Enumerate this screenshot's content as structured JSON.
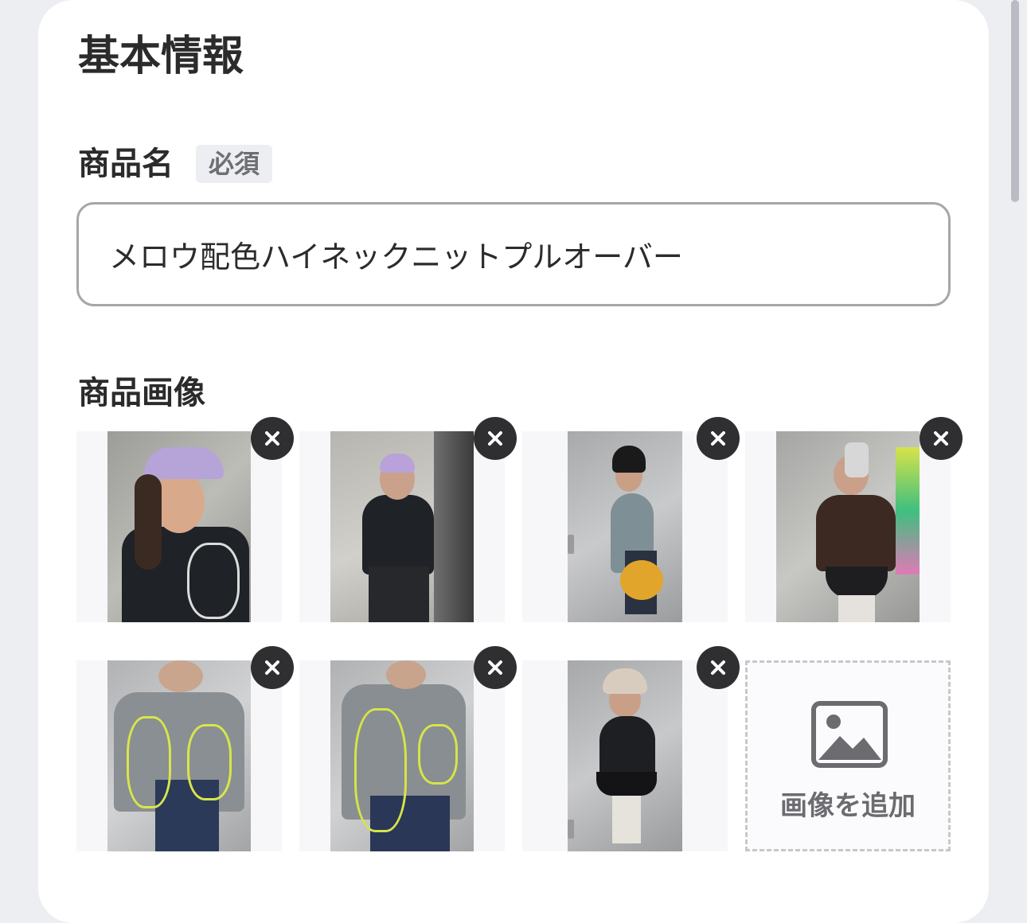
{
  "section": {
    "title": "基本情報"
  },
  "product_name": {
    "label": "商品名",
    "required_badge": "必須",
    "value": "メロウ配色ハイネックニットプルオーバー"
  },
  "product_images": {
    "label": "商品画像",
    "items": [
      {
        "icon": "photo-thumbnail",
        "remove_icon": "close-icon"
      },
      {
        "icon": "photo-thumbnail",
        "remove_icon": "close-icon"
      },
      {
        "icon": "photo-thumbnail",
        "remove_icon": "close-icon"
      },
      {
        "icon": "photo-thumbnail",
        "remove_icon": "close-icon"
      },
      {
        "icon": "photo-thumbnail",
        "remove_icon": "close-icon"
      },
      {
        "icon": "photo-thumbnail",
        "remove_icon": "close-icon"
      },
      {
        "icon": "photo-thumbnail",
        "remove_icon": "close-icon"
      }
    ],
    "add_button": {
      "label": "画像を追加",
      "icon": "image-icon"
    }
  },
  "colors": {
    "background": "#eceef1",
    "card": "#ffffff",
    "text": "#2b2b2b",
    "remove_button": "#2f2f32"
  }
}
